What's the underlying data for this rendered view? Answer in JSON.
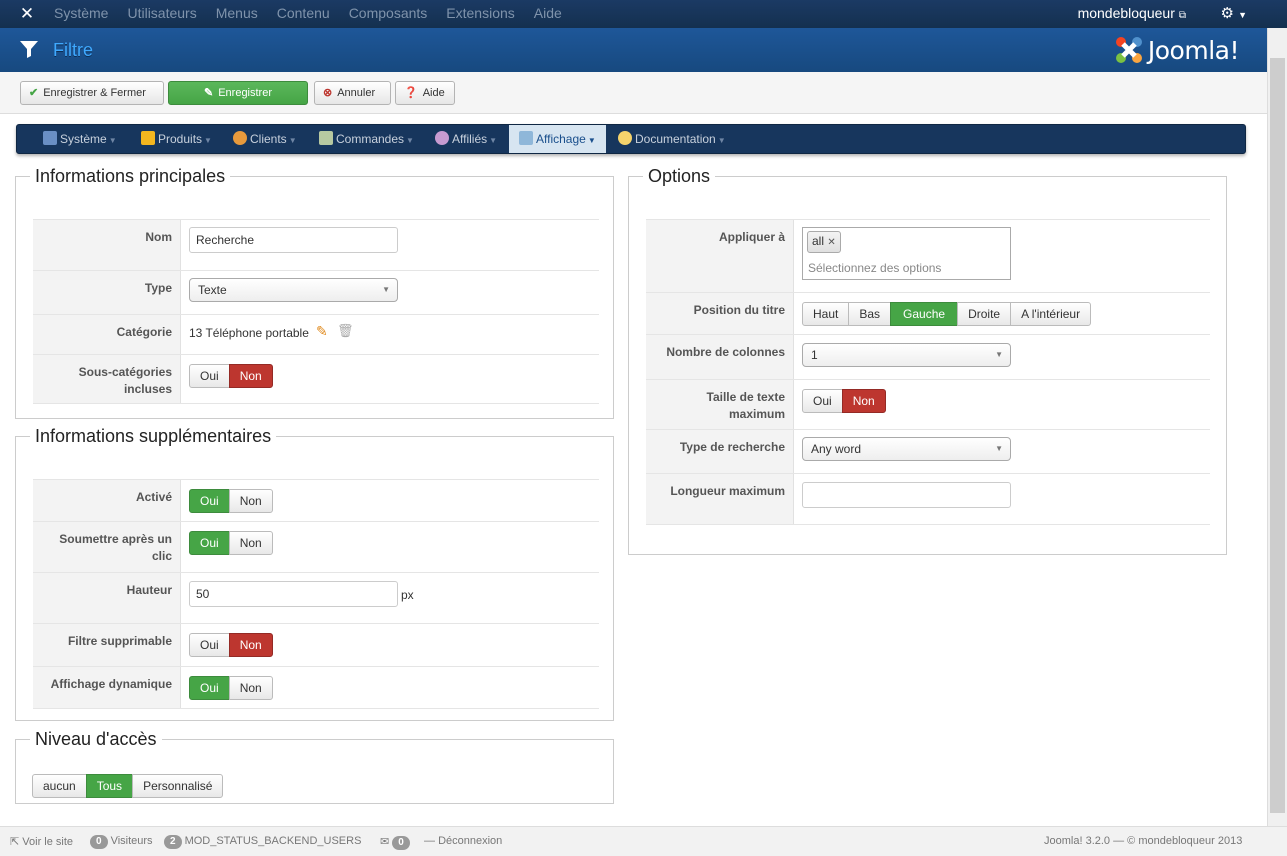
{
  "topbar": {
    "menu": [
      "Système",
      "Utilisateurs",
      "Menus",
      "Contenu",
      "Composants",
      "Extensions",
      "Aide"
    ],
    "user": "mondebloqueur"
  },
  "header": {
    "title": "Filtre",
    "brand": "Joomla!"
  },
  "toolbar": {
    "save_close": "Enregistrer & Fermer",
    "save": "Enregistrer",
    "cancel": "Annuler",
    "help": "Aide"
  },
  "subnav": [
    "Système",
    "Produits",
    "Clients",
    "Commandes",
    "Affiliés",
    "Affichage",
    "Documentation"
  ],
  "main_info": {
    "legend": "Informations principales",
    "nom_label": "Nom",
    "nom_value": "Recherche",
    "type_label": "Type",
    "type_value": "Texte",
    "categorie_label": "Catégorie",
    "categorie_value": "13 Téléphone portable",
    "sous_label": "Sous-catégories incluses"
  },
  "extra_info": {
    "legend": "Informations supplémentaires",
    "active_label": "Activé",
    "submit_label": "Soumettre après un clic",
    "hauteur_label": "Hauteur",
    "hauteur_value": "50",
    "hauteur_unit": "px",
    "removable_label": "Filtre supprimable",
    "dynamic_label": "Affichage dynamique"
  },
  "yes": "Oui",
  "no": "Non",
  "access": {
    "legend": "Niveau d'accès",
    "options": [
      "aucun",
      "Tous",
      "Personnalisé"
    ],
    "selected": "Tous"
  },
  "options": {
    "legend": "Options",
    "apply_label": "Appliquer à",
    "apply_tag": "all",
    "apply_placeholder": "Sélectionnez des options",
    "title_pos_label": "Position du titre",
    "title_pos_options": [
      "Haut",
      "Bas",
      "Gauche",
      "Droite",
      "A l'intérieur"
    ],
    "title_pos_selected": "Gauche",
    "columns_label": "Nombre de colonnes",
    "columns_value": "1",
    "maxtext_label": "Taille de texte maximum",
    "search_type_label": "Type de recherche",
    "search_type_value": "Any word",
    "maxlen_label": "Longueur maximum",
    "maxlen_value": ""
  },
  "status": {
    "view_site": "Voir le site",
    "visitors_count": "0",
    "visitors_label": "Visiteurs",
    "backend_count": "2",
    "backend_label": "MOD_STATUS_BACKEND_USERS",
    "msg_count": "0",
    "logout": "Déconnexion",
    "version": "Joomla! 3.2.0",
    "copyright": "© mondebloqueur 2013"
  },
  "colors": {
    "green": "#46a546",
    "red": "#bd362f",
    "navy": "#17365d",
    "blue": "#1e5799"
  }
}
